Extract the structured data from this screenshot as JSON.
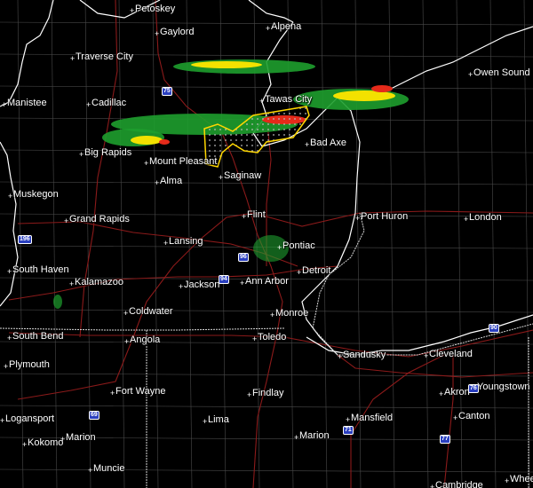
{
  "colors": {
    "background": "#000000",
    "water": "#000000",
    "shoreline": "#ffffff",
    "state_border": "#d8d8d8",
    "county_line": "#4a4a4a",
    "highway": "#8b1a1a",
    "warning_outline": "#ffd700",
    "radar_light": "#1e9f2e",
    "radar_mid": "#f3e100",
    "radar_heavy": "#e52a1a"
  },
  "cities": [
    {
      "id": "petoskey",
      "label": "Petoskey"
    },
    {
      "id": "gaylord",
      "label": "Gaylord"
    },
    {
      "id": "alpena",
      "label": "Alpena"
    },
    {
      "id": "traverse-city",
      "label": "Traverse City"
    },
    {
      "id": "owen-sound",
      "label": "Owen Sound"
    },
    {
      "id": "manistee",
      "label": "Manistee"
    },
    {
      "id": "cadillac",
      "label": "Cadillac"
    },
    {
      "id": "tawas-city",
      "label": "Tawas City"
    },
    {
      "id": "bad-axe",
      "label": "Bad Axe"
    },
    {
      "id": "big-rapids",
      "label": "Big Rapids"
    },
    {
      "id": "mount-pleasant",
      "label": "Mount Pleasant"
    },
    {
      "id": "alma",
      "label": "Alma"
    },
    {
      "id": "saginaw",
      "label": "Saginaw"
    },
    {
      "id": "muskegon",
      "label": "Muskegon"
    },
    {
      "id": "grand-rapids",
      "label": "Grand Rapids"
    },
    {
      "id": "flint",
      "label": "Flint"
    },
    {
      "id": "port-huron",
      "label": "Port Huron"
    },
    {
      "id": "london",
      "label": "London"
    },
    {
      "id": "lansing",
      "label": "Lansing"
    },
    {
      "id": "pontiac",
      "label": "Pontiac"
    },
    {
      "id": "south-haven",
      "label": "South Haven"
    },
    {
      "id": "detroit",
      "label": "Detroit"
    },
    {
      "id": "kalamazoo",
      "label": "Kalamazoo"
    },
    {
      "id": "jackson",
      "label": "Jackson"
    },
    {
      "id": "ann-arbor",
      "label": "Ann Arbor"
    },
    {
      "id": "coldwater",
      "label": "Coldwater"
    },
    {
      "id": "monroe",
      "label": "Monroe"
    },
    {
      "id": "south-bend",
      "label": "South Bend"
    },
    {
      "id": "angola",
      "label": "Angola"
    },
    {
      "id": "toledo",
      "label": "Toledo"
    },
    {
      "id": "sandusky",
      "label": "Sandusky"
    },
    {
      "id": "cleveland",
      "label": "Cleveland"
    },
    {
      "id": "plymouth",
      "label": "Plymouth"
    },
    {
      "id": "fort-wayne",
      "label": "Fort Wayne"
    },
    {
      "id": "findlay",
      "label": "Findlay"
    },
    {
      "id": "akron",
      "label": "Akron"
    },
    {
      "id": "youngstown",
      "label": "Youngstown"
    },
    {
      "id": "logansport",
      "label": "Logansport"
    },
    {
      "id": "lima",
      "label": "Lima"
    },
    {
      "id": "mansfield",
      "label": "Mansfield"
    },
    {
      "id": "canton",
      "label": "Canton"
    },
    {
      "id": "kokomo",
      "label": "Kokomo"
    },
    {
      "id": "marion-in",
      "label": "Marion"
    },
    {
      "id": "marion-oh",
      "label": "Marion"
    },
    {
      "id": "muncie",
      "label": "Muncie"
    },
    {
      "id": "cambridge",
      "label": "Cambridge"
    },
    {
      "id": "wheeling",
      "label": "Wheeling"
    }
  ],
  "shields": [
    {
      "id": "i75",
      "label": "75"
    },
    {
      "id": "i96",
      "label": "96"
    },
    {
      "id": "i196",
      "label": "196"
    },
    {
      "id": "i94",
      "label": "94"
    },
    {
      "id": "i90",
      "label": "90"
    },
    {
      "id": "i69",
      "label": "69"
    },
    {
      "id": "i71",
      "label": "71"
    },
    {
      "id": "i77",
      "label": "77"
    },
    {
      "id": "i76",
      "label": "76"
    }
  ]
}
